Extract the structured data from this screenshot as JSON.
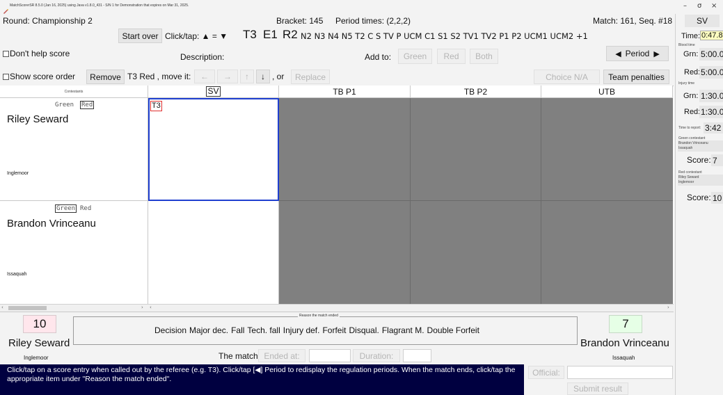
{
  "window": {
    "title": "MatchScorerSR 8.5.0 (Jan 16, 2025) using Java v1.8.0_431 - S/N 1 for Demonstration that expires on Mar 31, 2025.",
    "controls": [
      "–",
      "σ",
      "×"
    ]
  },
  "header": {
    "round": "Round: Championship 2",
    "bracket": "Bracket: 145",
    "period_times": "Period times: (2,2,2)",
    "match": "Match: 161, Seq. #18"
  },
  "toolbar1": {
    "start_over": "Start over",
    "click_tap": "Click/tap: ▲ = ▼",
    "big_codes": [
      "T3",
      "E1",
      "R2"
    ],
    "codes": "N2 N3 N4 N5 T2 C S TV P UCM C1 S1 S2 TV1 TV2 P1 P2 UCM1 UCM2 +1"
  },
  "toolbar2": {
    "dont_help": "Don't help score",
    "description": "Description:",
    "add_to": "Add to:",
    "green": "Green",
    "red": "Red",
    "both": "Both",
    "period_prev": "◀",
    "period": "Period",
    "period_next": "▶"
  },
  "toolbar3": {
    "show_order": "Show score order",
    "remove": "Remove",
    "move_text": "T3 Red , move it:",
    "arrows": [
      "←",
      "→",
      "↑",
      "↓"
    ],
    "or": ", or",
    "replace": "Replace",
    "choice": "Choice N/A",
    "team_penalties": "Team penalties"
  },
  "grid": {
    "contestants_header": "Contestants",
    "columns": [
      "SV",
      "TB P1",
      "TB P2",
      "UTB"
    ],
    "rows": [
      {
        "colors": [
          "Green",
          "Red"
        ],
        "selected": "Red",
        "name": "Riley Seward",
        "team": "Inglemoor",
        "sv_entry": "T3"
      },
      {
        "colors": [
          "Green",
          "Red"
        ],
        "selected": "Green",
        "name": "Brandon Vrinceanu",
        "team": "Issaquah",
        "sv_entry": ""
      }
    ]
  },
  "bottom": {
    "red_score": "10",
    "red_name": "Riley Seward",
    "red_team": "Inglemoor",
    "green_score": "7",
    "green_name": "Brandon Vrinceanu",
    "green_team": "Issaquah",
    "reason_title": "Reason the match ended",
    "reasons": [
      "Decision",
      "Major dec.",
      "Fall",
      "Tech. fall",
      "Injury def.",
      "Forfeit",
      "Disqual.",
      "Flagrant M.",
      "Double Forfeit"
    ],
    "the_match": "The match",
    "ended_at": "Ended at:",
    "duration": "Duration:",
    "official": "Official:",
    "submit": "Submit result",
    "help_text": "Click/tap on a score entry when called out by the referee (e.g. T3). Click/tap [◀] Period to redisplay the regulation periods. When the match ends, click/tap the appropriate item under \"Reason the match ended\"."
  },
  "right_panel": {
    "period_label": "SV",
    "time_label": "Time:",
    "time_value": "0:47.8",
    "blood_label": "Blood time",
    "grn_label": "Grn:",
    "blood_grn": "5:00.0",
    "red_label": "Red:",
    "blood_red": "5:00.0",
    "injury_label": "Injury time",
    "injury_grn": "1:30.0",
    "injury_red": "1:30.0",
    "report_label": "Time to report:",
    "report_value": "3:42",
    "green_contestant_label": "Green contestant",
    "green_contestant_name": "Brandon Vrinceanu",
    "green_contestant_team": "Issaquah",
    "score_label": "Score:",
    "green_score": "7",
    "red_contestant_label": "Red contestant",
    "red_contestant_name": "Riley Seward",
    "red_contestant_team": "Inglemoor",
    "red_score": "10"
  },
  "colors": {
    "red_score_bg": "#ffe6ec",
    "green_score_bg": "#e6ffe6",
    "help_bg": "#000040",
    "grid_gray": "#808080",
    "selection_blue": "#1f3fd0",
    "time_highlight": "#ffffc0"
  }
}
